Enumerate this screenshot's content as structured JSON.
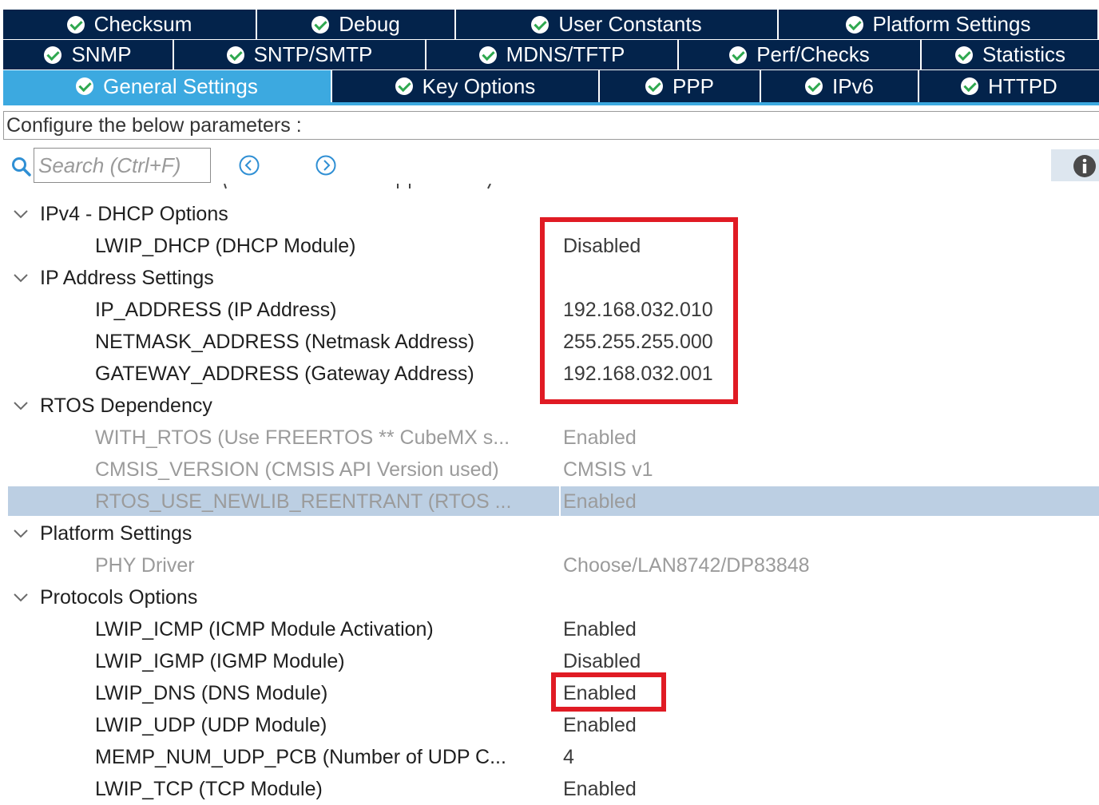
{
  "tabs": {
    "row1": [
      {
        "label": "Checksum",
        "width": 316
      },
      {
        "label": "Debug",
        "width": 247
      },
      {
        "label": "User Constants",
        "width": 402
      },
      {
        "label": "Platform Settings",
        "width": 399
      }
    ],
    "row2": [
      {
        "label": "SNMP",
        "width": 212
      },
      {
        "label": "SNTP/SMTP",
        "width": 314
      },
      {
        "label": "MDNS/TFTP",
        "width": 314
      },
      {
        "label": "Perf/Checks",
        "width": 302
      },
      {
        "label": "Statistics",
        "width": 222
      }
    ],
    "row3": [
      {
        "label": "General Settings",
        "width": 410,
        "active": true
      },
      {
        "label": "Key Options",
        "width": 333
      },
      {
        "label": "PPP",
        "width": 200
      },
      {
        "label": "IPv6",
        "width": 196
      },
      {
        "label": "HTTPD",
        "width": 225
      }
    ]
  },
  "config_label": "Configure the below parameters :",
  "search": {
    "placeholder": "Search (Ctrl+F)"
  },
  "groups": [
    {
      "title": "IPv4 - DHCP Options",
      "params": [
        {
          "name": "LWIP_DHCP (DHCP Module)",
          "value": "Disabled"
        }
      ]
    },
    {
      "title": "IP Address Settings",
      "params": [
        {
          "name": "IP_ADDRESS (IP Address)",
          "value": "192.168.032.010"
        },
        {
          "name": "NETMASK_ADDRESS (Netmask Address)",
          "value": "255.255.255.000"
        },
        {
          "name": "GATEWAY_ADDRESS (Gateway Address)",
          "value": "192.168.032.001"
        }
      ]
    },
    {
      "title": "RTOS Dependency",
      "params": [
        {
          "name": "WITH_RTOS (Use FREERTOS ** CubeMX s...",
          "value": "Enabled",
          "disabled": true
        },
        {
          "name": "CMSIS_VERSION (CMSIS API Version used)",
          "value": "CMSIS v1",
          "disabled": true
        },
        {
          "name": "RTOS_USE_NEWLIB_REENTRANT (RTOS ...",
          "value": "Enabled",
          "disabled": true,
          "selected": true
        }
      ]
    },
    {
      "title": "Platform Settings",
      "params": [
        {
          "name": "PHY Driver",
          "value": "Choose/LAN8742/DP83848",
          "disabled": true
        }
      ]
    },
    {
      "title": "Protocols Options",
      "params": [
        {
          "name": "LWIP_ICMP (ICMP Module Activation)",
          "value": "Enabled"
        },
        {
          "name": "LWIP_IGMP (IGMP Module)",
          "value": "Disabled"
        },
        {
          "name": "LWIP_DNS (DNS Module)",
          "value": "Enabled"
        },
        {
          "name": "LWIP_UDP (UDP Module)",
          "value": "Enabled"
        },
        {
          "name": "MEMP_NUM_UDP_PCB (Number of UDP C...",
          "value": "4"
        },
        {
          "name": "LWIP_TCP (TCP Module)",
          "value": "Enabled"
        }
      ]
    }
  ],
  "colors": {
    "tab_bg": "#03234b",
    "tab_active": "#3ca9e0",
    "highlight_box": "#e01b24",
    "selected_row": "#bccfe3"
  }
}
